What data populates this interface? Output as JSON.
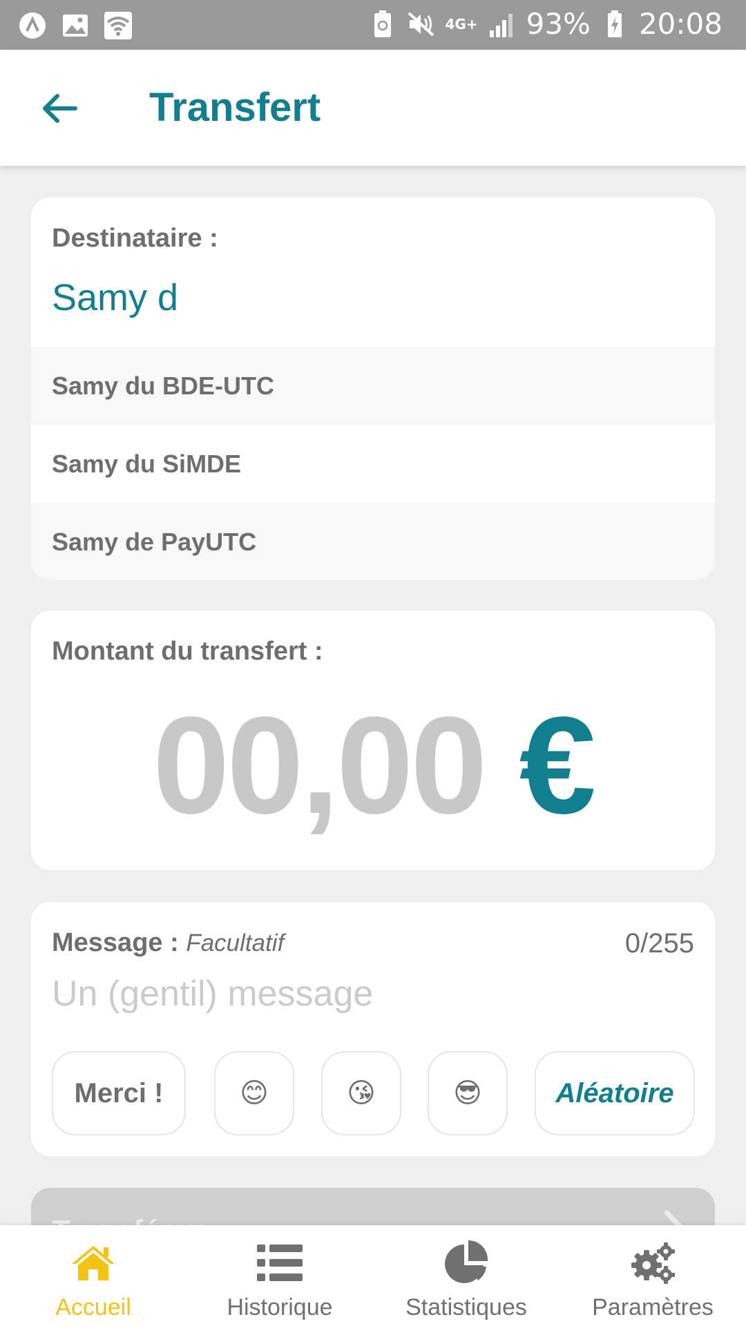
{
  "statusbar": {
    "battery": "93%",
    "time": "20:08",
    "network": "4G+"
  },
  "header": {
    "title": "Transfert"
  },
  "recipient": {
    "label": "Destinataire :",
    "value": "Samy d",
    "suggestions": [
      "Samy du BDE-UTC",
      "Samy du SiMDE",
      "Samy de PayUTC"
    ]
  },
  "amount": {
    "label": "Montant du transfert :",
    "value": "00,00",
    "currency": "€"
  },
  "message": {
    "label": "Message :",
    "optional": "Facultatif",
    "counter": "0/255",
    "placeholder": "Un (gentil) message",
    "chips": {
      "merci": "Merci !",
      "emoji1": "😊",
      "emoji2": "😘",
      "emoji3": "😎",
      "random": "Aléatoire"
    }
  },
  "transfer_button": {
    "label": "Transférer"
  },
  "nav": [
    {
      "label": "Accueil",
      "icon": "home-icon",
      "active": true
    },
    {
      "label": "Historique",
      "icon": "list-icon"
    },
    {
      "label": "Statistiques",
      "icon": "pie-chart-icon"
    },
    {
      "label": "Paramètres",
      "icon": "gears-icon"
    }
  ],
  "colors": {
    "accent": "#127f8f",
    "active_nav": "#f5c313",
    "statusbar": "#9a9a9a"
  }
}
